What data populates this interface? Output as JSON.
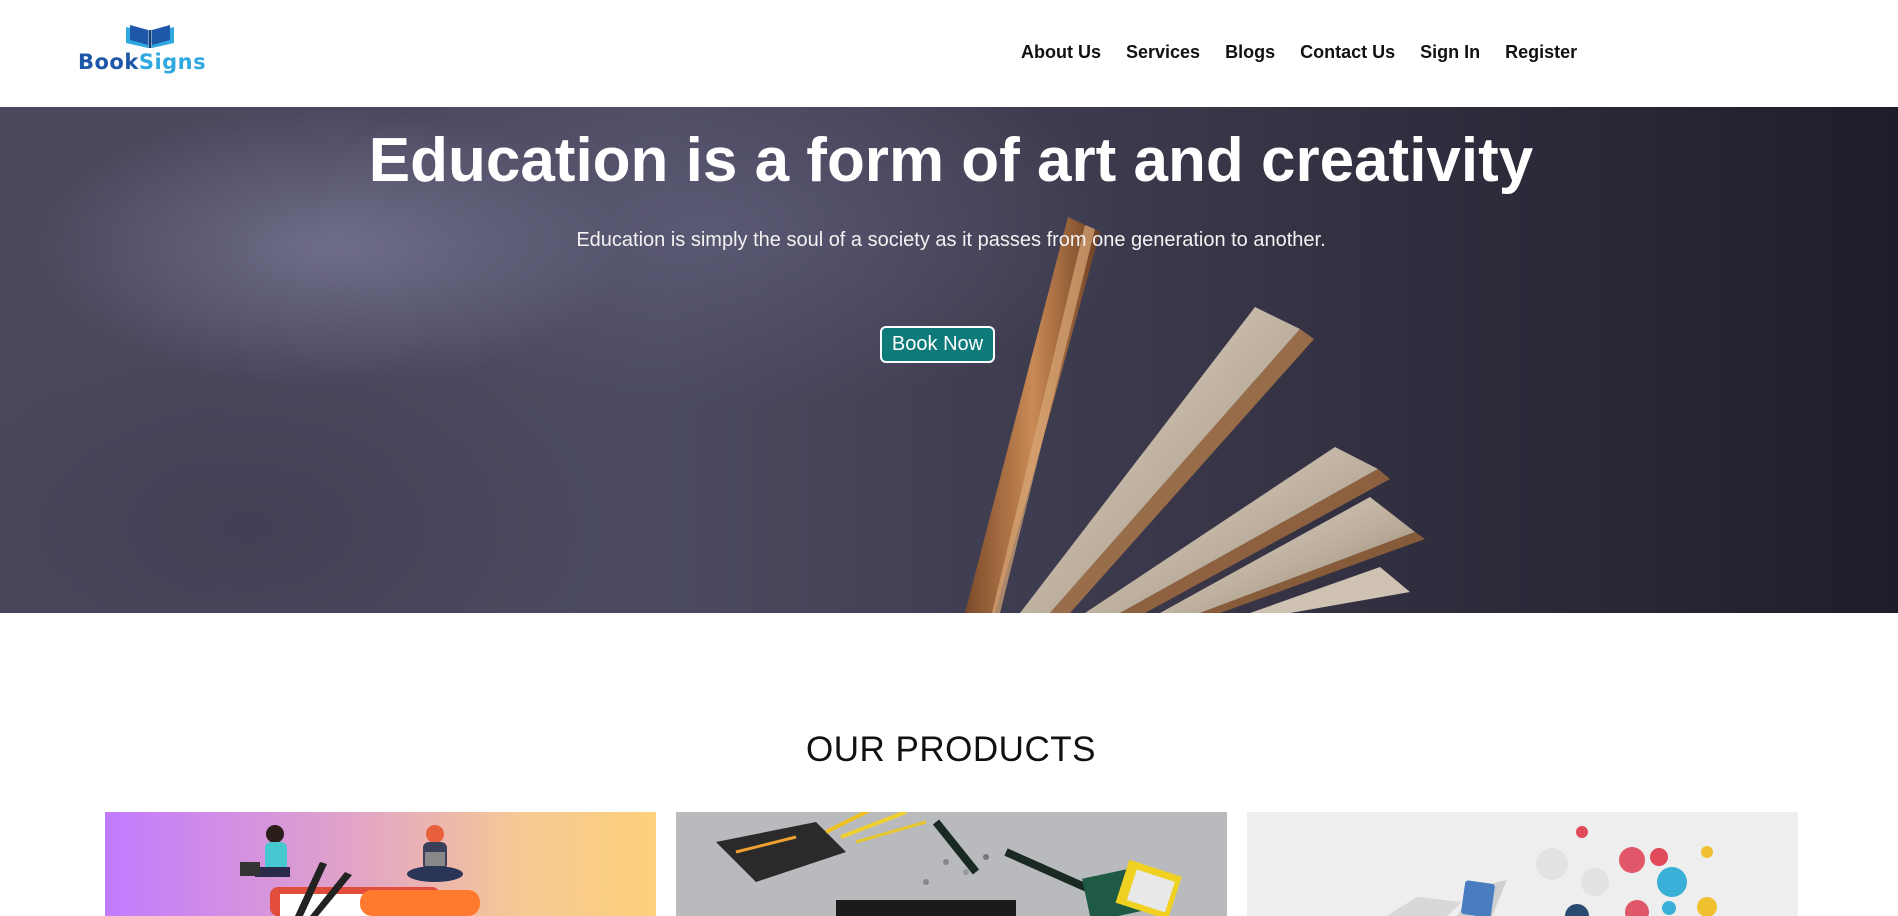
{
  "brand": {
    "name_part1": "Book",
    "name_part2": "Signs",
    "color_primary": "#1f57a8",
    "color_secondary": "#2fa8e0",
    "icon": "open-book-icon"
  },
  "nav": {
    "items": [
      {
        "label": "About Us"
      },
      {
        "label": "Services"
      },
      {
        "label": "Blogs"
      },
      {
        "label": "Contact Us"
      },
      {
        "label": "Sign In"
      },
      {
        "label": "Register"
      }
    ]
  },
  "hero": {
    "title": "Education is a form of art and creativity",
    "subtitle": "Education is simply the soul of a society as it passes from one generation to another.",
    "button_label": "Book Now",
    "button_color": "#0e7a7a"
  },
  "products": {
    "title": "OUR PRODUCTS",
    "cards": [
      {
        "image": "people-on-books-illustration"
      },
      {
        "image": "robot-arm-electronics-photo"
      },
      {
        "image": "tablet-app-icons-illustration"
      }
    ]
  }
}
